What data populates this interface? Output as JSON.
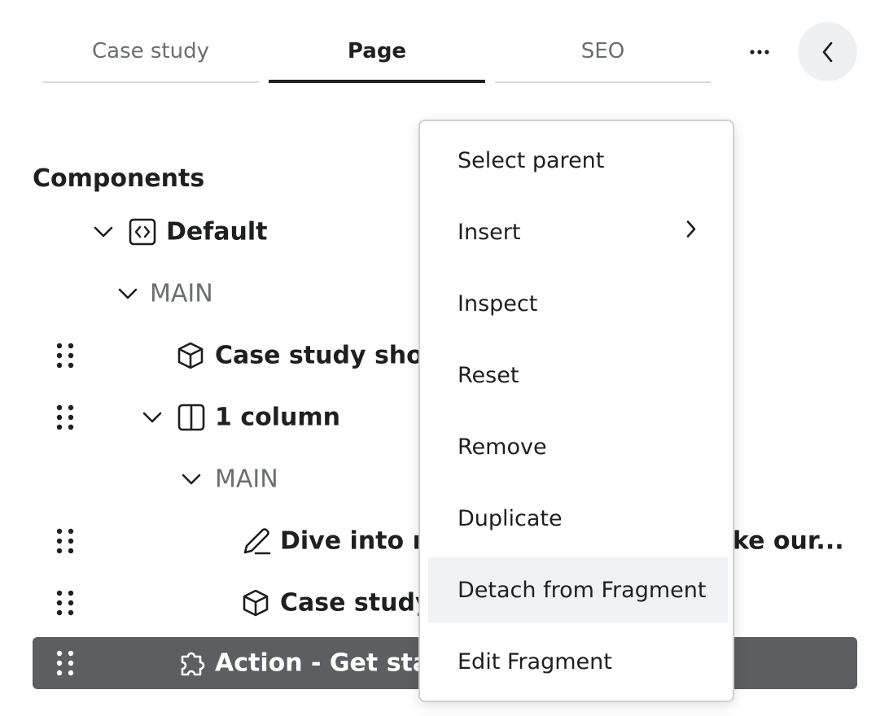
{
  "tabs": [
    {
      "label": "Case study",
      "active": false
    },
    {
      "label": "Page",
      "active": true
    },
    {
      "label": "SEO",
      "active": false
    }
  ],
  "header": {
    "more_icon": "ellipsis-icon",
    "back_icon": "chevron-left-icon"
  },
  "components": {
    "title": "Components",
    "tree": [
      {
        "label": "Default",
        "icon": "code-bracket-icon",
        "expanded": true
      },
      {
        "label": "MAIN",
        "type": "region",
        "expanded": true
      },
      {
        "label": "Case study show",
        "icon": "cube-icon"
      },
      {
        "label": "1 column",
        "icon": "columns-icon",
        "expanded": true
      },
      {
        "label": "MAIN",
        "type": "region",
        "expanded": true
      },
      {
        "label": "Dive into m",
        "trailing": "ke our...",
        "icon": "pencil-icon"
      },
      {
        "label": "Case study",
        "icon": "cube-icon"
      },
      {
        "label": "Action - Get star",
        "icon": "puzzle-icon",
        "selected": true
      }
    ]
  },
  "context_menu": {
    "items": [
      {
        "label": "Select parent"
      },
      {
        "label": "Insert",
        "submenu": true
      },
      {
        "label": "Inspect"
      },
      {
        "label": "Reset"
      },
      {
        "label": "Remove"
      },
      {
        "label": "Duplicate"
      },
      {
        "label": "Detach from Fragment",
        "highlighted": true
      },
      {
        "label": "Edit Fragment"
      }
    ]
  },
  "colors": {
    "text": "#1e1f21",
    "muted": "#6b6e72",
    "selected_row": "#5c5e60",
    "menu_hover": "#f0f2f3",
    "back_button_bg": "#eef0f1"
  }
}
